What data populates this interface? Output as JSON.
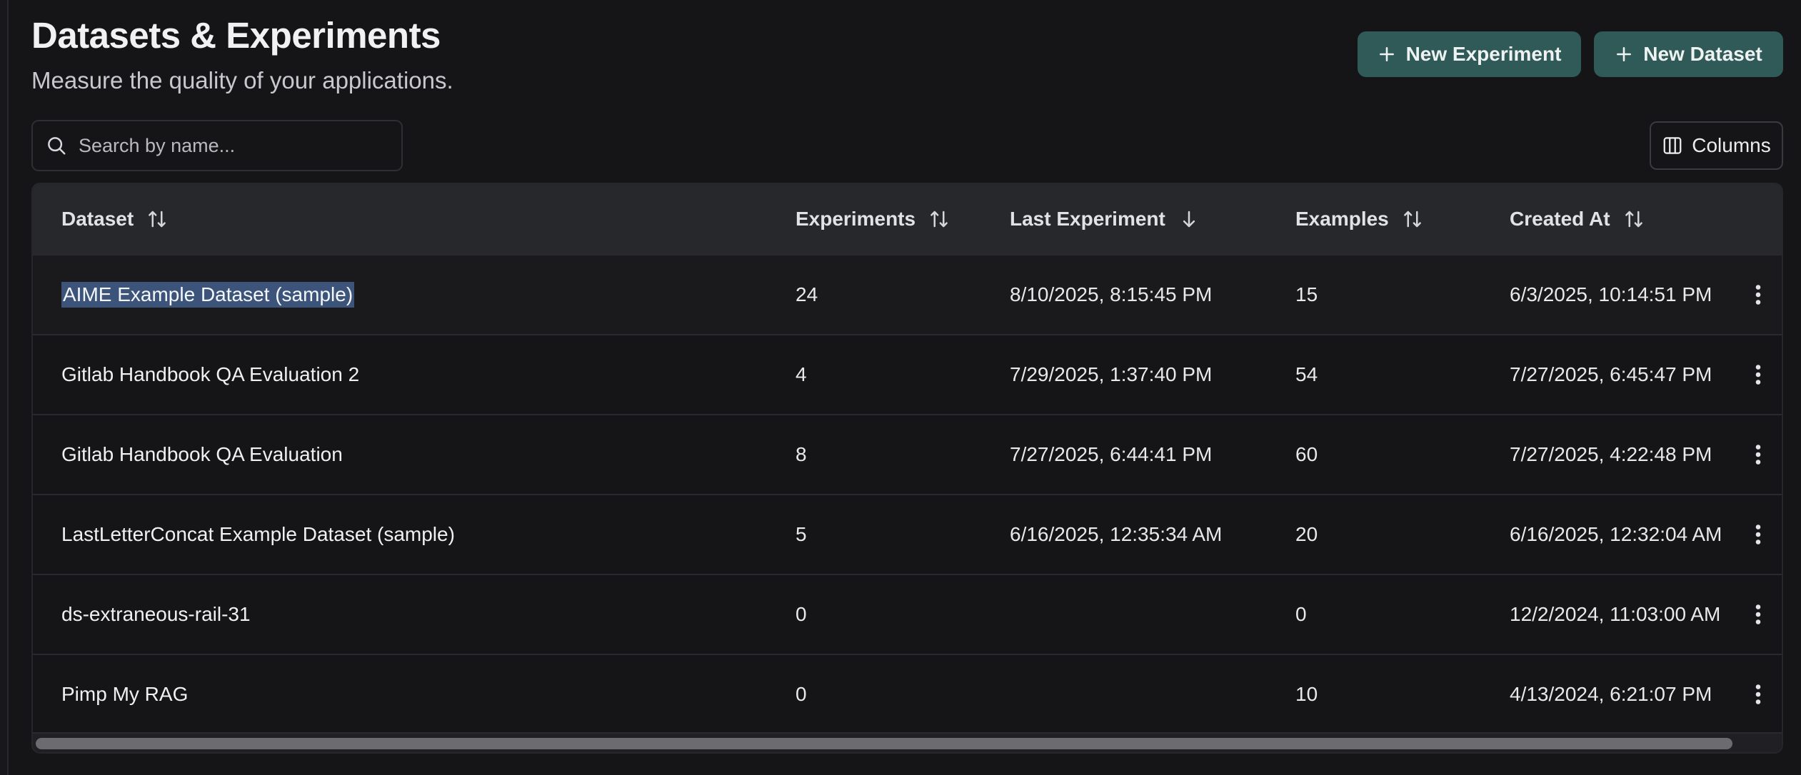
{
  "header": {
    "title": "Datasets & Experiments",
    "subtitle": "Measure the quality of your applications."
  },
  "actions": {
    "new_experiment_label": "New Experiment",
    "new_dataset_label": "New Dataset",
    "columns_label": "Columns"
  },
  "search": {
    "placeholder": "Search by name...",
    "value": ""
  },
  "table": {
    "columns": [
      {
        "label": "Dataset",
        "sort_icon": "sort-both-icon"
      },
      {
        "label": "Experiments",
        "sort_icon": "sort-both-icon"
      },
      {
        "label": "Last Experiment",
        "sort_icon": "sort-desc-icon"
      },
      {
        "label": "Examples",
        "sort_icon": "sort-both-icon"
      },
      {
        "label": "Created At",
        "sort_icon": "sort-both-icon"
      }
    ],
    "rows": [
      {
        "dataset": "AIME Example Dataset (sample)",
        "experiments": "24",
        "last_experiment": "8/10/2025, 8:15:45 PM",
        "examples": "15",
        "created_at": "6/3/2025, 10:14:51 PM"
      },
      {
        "dataset": "Gitlab Handbook QA Evaluation 2",
        "experiments": "4",
        "last_experiment": "7/29/2025, 1:37:40 PM",
        "examples": "54",
        "created_at": "7/27/2025, 6:45:47 PM"
      },
      {
        "dataset": "Gitlab Handbook QA Evaluation",
        "experiments": "8",
        "last_experiment": "7/27/2025, 6:44:41 PM",
        "examples": "60",
        "created_at": "7/27/2025, 4:22:48 PM"
      },
      {
        "dataset": "LastLetterConcat Example Dataset (sample)",
        "experiments": "5",
        "last_experiment": "6/16/2025, 12:35:34 AM",
        "examples": "20",
        "created_at": "6/16/2025, 12:32:04 AM"
      },
      {
        "dataset": "ds-extraneous-rail-31",
        "experiments": "0",
        "last_experiment": "",
        "examples": "0",
        "created_at": "12/2/2024, 11:03:00 AM"
      },
      {
        "dataset": "Pimp My RAG",
        "experiments": "0",
        "last_experiment": "",
        "examples": "10",
        "created_at": "4/13/2024, 6:21:07 PM"
      }
    ],
    "row_menu_icon": "kebab-menu-icon"
  },
  "colors": {
    "background": "#151517",
    "header_row": "#27282b",
    "primary_button": "#2f5a58",
    "selection_highlight": "#3c5479"
  }
}
